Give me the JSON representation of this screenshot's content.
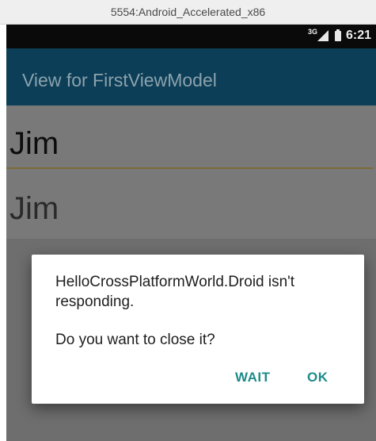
{
  "window": {
    "title": "5554:Android_Accelerated_x86"
  },
  "status_bar": {
    "network": "3G",
    "time": "6:21"
  },
  "app_bar": {
    "title": "View for FirstViewModel"
  },
  "main": {
    "text_input_value": "Jim",
    "label_value": "Jim"
  },
  "dialog": {
    "message": "HelloCrossPlatformWorld.Droid isn't responding.",
    "question": "Do you want to close it?",
    "wait_label": "WAIT",
    "ok_label": "OK"
  },
  "colors": {
    "app_bar": "#0d3e57",
    "accent": "#1d8c8a",
    "underline": "#7a6a35"
  }
}
